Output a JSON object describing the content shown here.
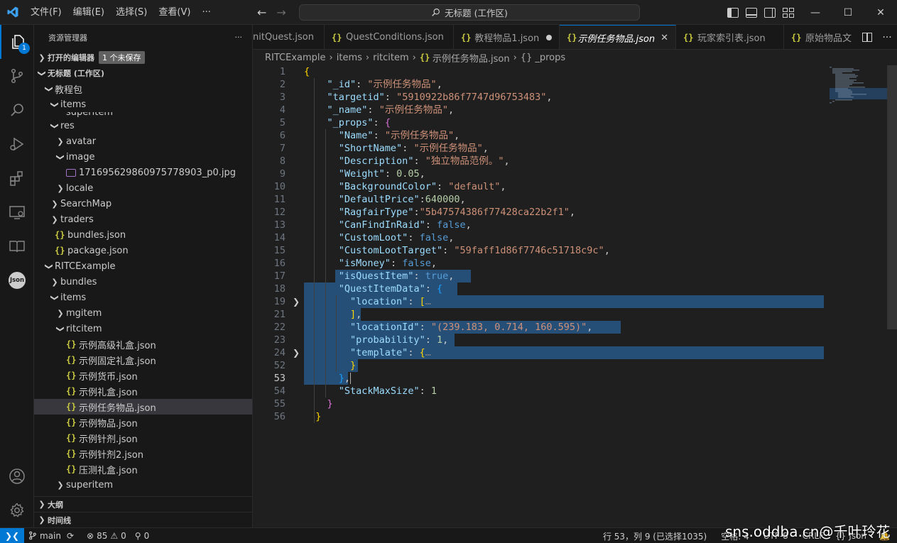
{
  "titlebar": {
    "menu": [
      "文件(F)",
      "编辑(E)",
      "选择(S)",
      "查看(V)",
      "···"
    ],
    "command_center": "无标题 (工作区)",
    "window_controls": {
      "minimize": "—",
      "maximize": "☐",
      "close": "✕"
    }
  },
  "activitybar": {
    "explorer_badge": "1",
    "json_label": "Json"
  },
  "sidebar": {
    "title": "资源管理器",
    "more": "···",
    "open_editors": {
      "label": "打开的编辑器",
      "badge": "1 个未保存"
    },
    "workspace": "无标题 (工作区)",
    "tree": [
      {
        "label": "教程包",
        "depth": 0,
        "kind": "folder-open"
      },
      {
        "label": "items",
        "depth": 1,
        "kind": "folder-open"
      },
      {
        "label": "superitem",
        "depth": 2,
        "kind": "clipped"
      },
      {
        "label": "res",
        "depth": 1,
        "kind": "folder-open"
      },
      {
        "label": "avatar",
        "depth": 2,
        "kind": "folder"
      },
      {
        "label": "image",
        "depth": 2,
        "kind": "folder-open"
      },
      {
        "label": "1716956298609757789​03_p0.jpg",
        "depth": 3,
        "kind": "image"
      },
      {
        "label": "locale",
        "depth": 2,
        "kind": "folder"
      },
      {
        "label": "SearchMap",
        "depth": 1,
        "kind": "folder"
      },
      {
        "label": "traders",
        "depth": 1,
        "kind": "folder"
      },
      {
        "label": "bundles.json",
        "depth": 1,
        "kind": "json"
      },
      {
        "label": "package.json",
        "depth": 1,
        "kind": "json"
      },
      {
        "label": "RITCExample",
        "depth": 0,
        "kind": "folder-open"
      },
      {
        "label": "bundles",
        "depth": 1,
        "kind": "folder"
      },
      {
        "label": "items",
        "depth": 1,
        "kind": "folder-open"
      },
      {
        "label": "mgitem",
        "depth": 2,
        "kind": "folder"
      },
      {
        "label": "ritcitem",
        "depth": 2,
        "kind": "folder-open"
      },
      {
        "label": "示例高级礼盒.json",
        "depth": 3,
        "kind": "json"
      },
      {
        "label": "示例固定礼盒.json",
        "depth": 3,
        "kind": "json"
      },
      {
        "label": "示例货币.json",
        "depth": 3,
        "kind": "json"
      },
      {
        "label": "示例礼盒.json",
        "depth": 3,
        "kind": "json"
      },
      {
        "label": "示例任务物品.json",
        "depth": 3,
        "kind": "json",
        "selected": true
      },
      {
        "label": "示例物品.json",
        "depth": 3,
        "kind": "json"
      },
      {
        "label": "示例针剂.json",
        "depth": 3,
        "kind": "json"
      },
      {
        "label": "示例针剂2.json",
        "depth": 3,
        "kind": "json"
      },
      {
        "label": "压测礼盒.json",
        "depth": 3,
        "kind": "json"
      },
      {
        "label": "superitem",
        "depth": 2,
        "kind": "folder"
      }
    ],
    "outline": "大纲",
    "timeline": "时间线"
  },
  "tabs": [
    {
      "label": "nitQuest.json",
      "icon": false
    },
    {
      "label": "QuestConditions.json",
      "icon": true
    },
    {
      "label": "教程物品1.json",
      "icon": true,
      "dirty": true
    },
    {
      "label": "示例任务物品.json",
      "icon": true,
      "active": true
    },
    {
      "label": "玩家索引表.json",
      "icon": true
    },
    {
      "label": "原始物品文",
      "icon": true
    }
  ],
  "breadcrumb": [
    "RITCExample",
    "items",
    "ritcitem",
    "示例任务物品.json",
    "_props"
  ],
  "editor": {
    "current_line": "53",
    "line_numbers": [
      "1",
      "2",
      "3",
      "4",
      "5",
      "6",
      "7",
      "8",
      "9",
      "10",
      "11",
      "12",
      "13",
      "14",
      "15",
      "16",
      "17",
      "18",
      "19",
      "21",
      "22",
      "23",
      "24",
      "52",
      "53",
      "54",
      "55",
      "56"
    ]
  },
  "code": {
    "_id": "\"示例任务物品\"",
    "targetid": "\"5910922b86f7747d96753483\"",
    "_name": "\"示例任务物品\"",
    "Name": "\"示例任务物品\"",
    "ShortName": "\"示例任务物品\"",
    "Description": "\"独立物品范例。\"",
    "Weight": "0.05",
    "BackgroundColor": "\"default\"",
    "DefaultPrice": "640000",
    "RagfairType": "\"5b47574386f77428ca22b2f1\"",
    "CanFindInRaid": "false",
    "CustomLoot": "false",
    "CustomLootTarget": "\"59faff1d86f7746c51718c9c\"",
    "isMoney": "false",
    "isQuestItem": "true",
    "locationId": "\"(239.183, 0.714, 160.595)\"",
    "probability": "1",
    "StackMaxSize": "1",
    "ellipsis": "…"
  },
  "statusbar": {
    "branch": "main",
    "errors": "85",
    "warnings": "0",
    "ports": "0",
    "position": "行 53，列 9 (已选择1035)",
    "spaces": "空格: 4",
    "encoding": "UTF-8",
    "eol": "CRLF",
    "language": "Json"
  },
  "watermark": "sns.oddba.cn@千叶玲花",
  "colors": {
    "accent": "#0078d4",
    "selection": "#264f78",
    "key": "#9cdcfe",
    "string": "#ce9178",
    "number": "#b5cea8",
    "keyword": "#569cd6"
  }
}
